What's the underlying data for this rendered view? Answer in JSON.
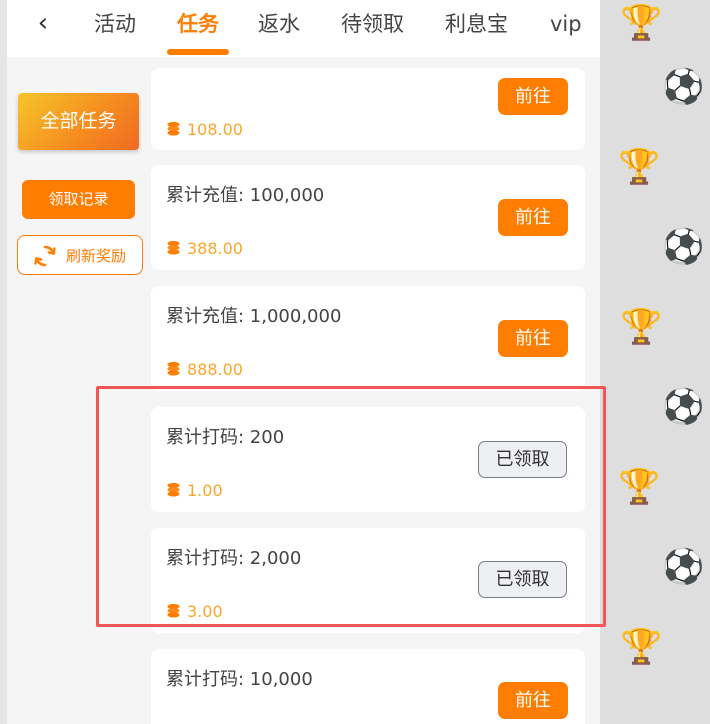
{
  "nav": {
    "back_icon": "chevron-left-icon",
    "tabs": [
      {
        "label": "活动",
        "active": false
      },
      {
        "label": "任务",
        "active": true
      },
      {
        "label": "返水",
        "active": false
      },
      {
        "label": "待领取",
        "active": false
      },
      {
        "label": "利息宝",
        "active": false
      },
      {
        "label": "vip",
        "active": false
      }
    ]
  },
  "sidebar": {
    "all_tasks_label": "全部任务",
    "record_label": "领取记录",
    "refresh_label": "刷新奖励",
    "refresh_icon": "refresh-icon"
  },
  "tasks": [
    {
      "title": "",
      "reward": "108.00",
      "action": "前往",
      "status": "go"
    },
    {
      "title": "累计充值: 100,000",
      "reward": "388.00",
      "action": "前往",
      "status": "go"
    },
    {
      "title": "累计充值: 1,000,000",
      "reward": "888.00",
      "action": "前往",
      "status": "go"
    },
    {
      "title": "累计打码: 200",
      "reward": "1.00",
      "action": "已领取",
      "status": "claimed"
    },
    {
      "title": "累计打码: 2,000",
      "reward": "3.00",
      "action": "已领取",
      "status": "claimed"
    },
    {
      "title": "累计打码: 10,000",
      "reward": "",
      "action": "前往",
      "status": "go"
    }
  ],
  "colors": {
    "accent": "#ff7d00",
    "reward_text": "#f7a72c",
    "highlight_border": "#f25757",
    "claimed_bg": "#eeeff3"
  },
  "reward_icon": "coin-stack-icon",
  "background_icons": [
    "trophy-icon",
    "soccer-ball-icon",
    "fifa-logo-icon"
  ]
}
